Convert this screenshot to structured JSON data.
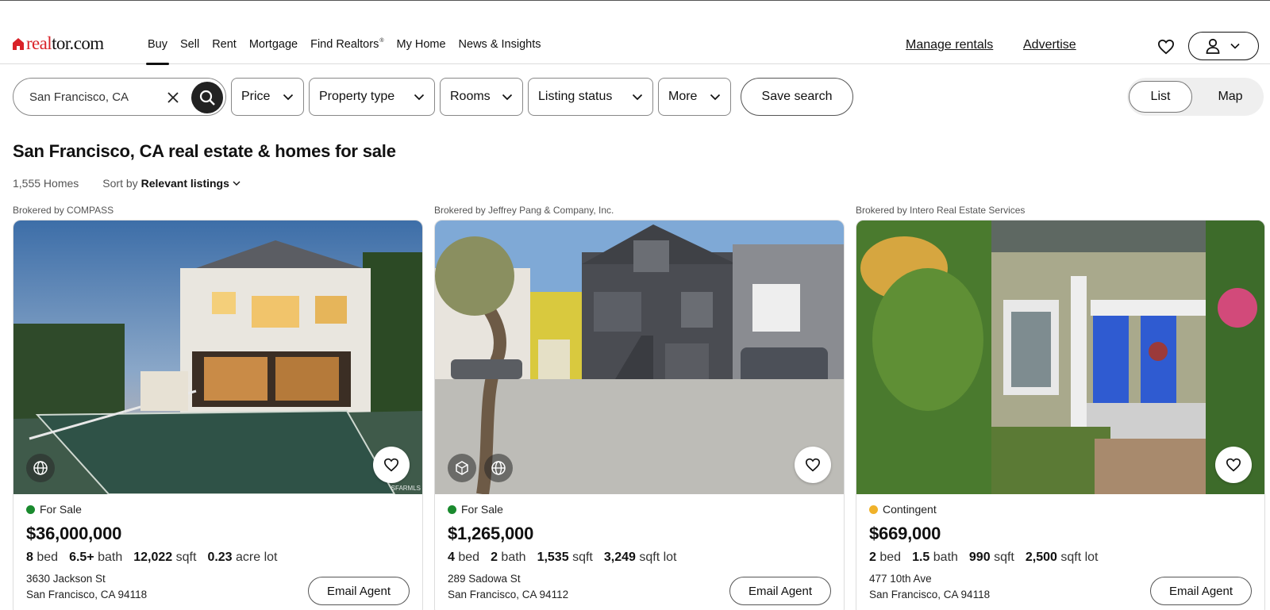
{
  "header": {
    "logo_text_accent": "real",
    "logo_text_rest": "tor.com",
    "nav": [
      {
        "label": "Buy"
      },
      {
        "label": "Sell"
      },
      {
        "label": "Rent"
      },
      {
        "label": "Mortgage"
      },
      {
        "label": "Find Realtors"
      },
      {
        "label": "My Home"
      },
      {
        "label": "News & Insights"
      }
    ],
    "find_realtors_mark": "®",
    "manage_rentals": "Manage rentals",
    "advertise": "Advertise"
  },
  "search": {
    "value": "San Francisco, CA"
  },
  "filters": {
    "price": "Price",
    "property_type": "Property type",
    "rooms": "Rooms",
    "listing_status": "Listing status",
    "more": "More",
    "save_search": "Save search"
  },
  "view_toggle": {
    "list": "List",
    "map": "Map",
    "selected": "List"
  },
  "results": {
    "title": "San Francisco, CA real estate & homes for sale",
    "count": "1,555 Homes",
    "sort_prefix": "Sort by",
    "sort_value": "Relevant listings"
  },
  "listings": [
    {
      "broker": "Brokered by COMPASS",
      "status": "For Sale",
      "status_color": "#1a8a2e",
      "price": "$36,000,000",
      "beds": "8",
      "beds_unit": "bed",
      "baths": "6.5+",
      "baths_unit": "bath",
      "sqft": "12,022",
      "sqft_unit": "sqft",
      "lot": "0.23",
      "lot_unit": "acre lot",
      "address1": "3630 Jackson St",
      "address2": "San Francisco, CA 94118",
      "email": "Email Agent",
      "watermark": "SFARMLS"
    },
    {
      "broker": "Brokered by Jeffrey Pang & Company, Inc.",
      "status": "For Sale",
      "status_color": "#1a8a2e",
      "price": "$1,265,000",
      "beds": "4",
      "beds_unit": "bed",
      "baths": "2",
      "baths_unit": "bath",
      "sqft": "1,535",
      "sqft_unit": "sqft",
      "lot": "3,249",
      "lot_unit": "sqft lot",
      "address1": "289 Sadowa St",
      "address2": "San Francisco, CA 94112",
      "email": "Email Agent"
    },
    {
      "broker": "Brokered by Intero Real Estate Services",
      "status": "Contingent",
      "status_color": "#f0b22a",
      "price": "$669,000",
      "beds": "2",
      "beds_unit": "bed",
      "baths": "1.5",
      "baths_unit": "bath",
      "sqft": "990",
      "sqft_unit": "sqft",
      "lot": "2,500",
      "lot_unit": "sqft lot",
      "address1": "477 10th Ave",
      "address2": "San Francisco, CA 94118",
      "email": "Email Agent"
    }
  ],
  "colors": {
    "brand_red": "#d92228",
    "text": "#111111",
    "border": "#888888"
  }
}
